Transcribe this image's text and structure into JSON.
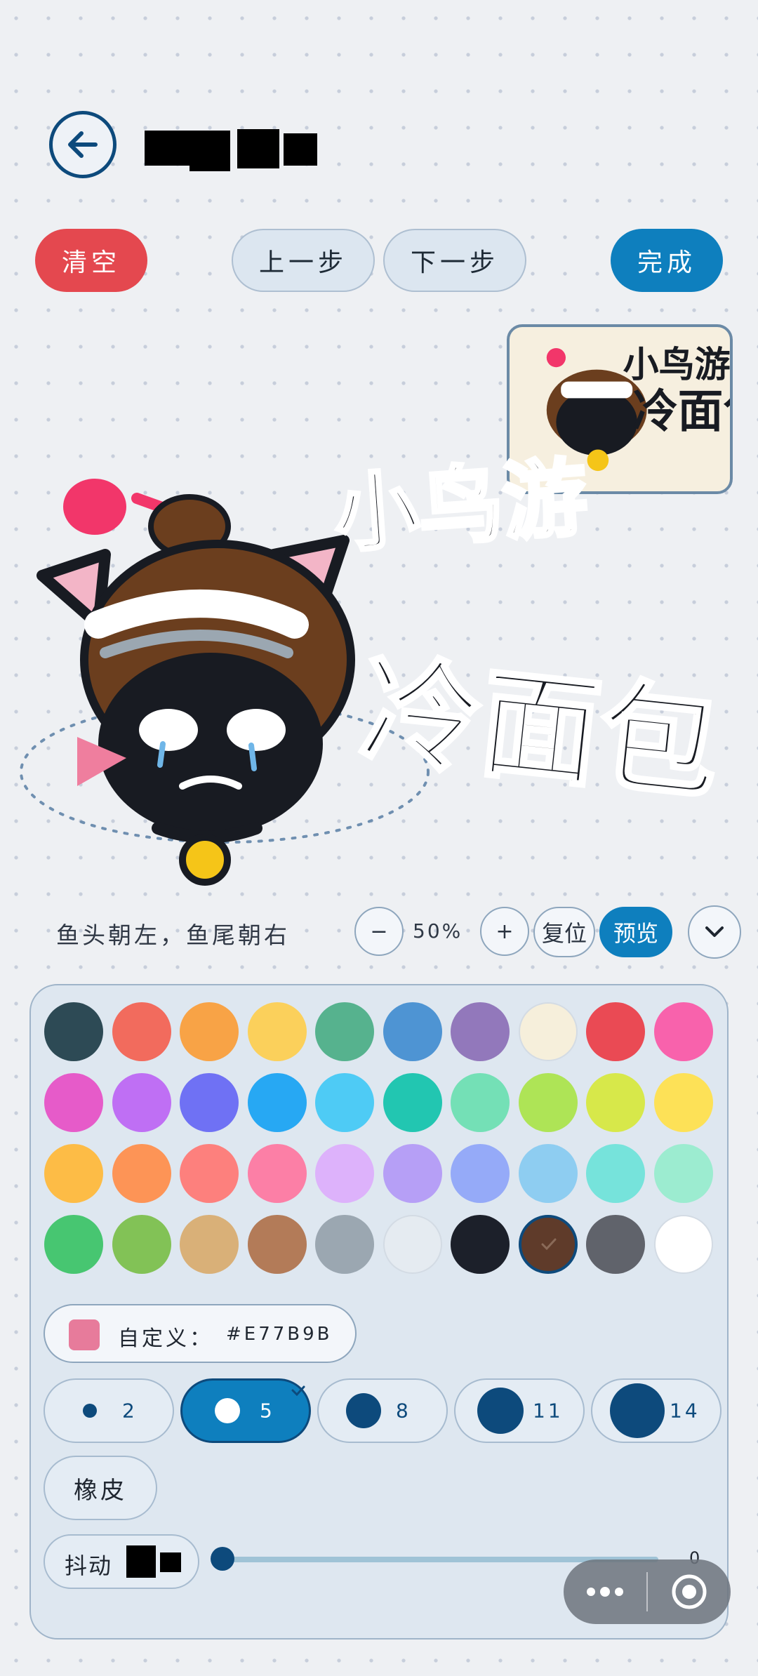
{
  "header": {
    "title": "████ █"
  },
  "toolbar": {
    "clear": "清空",
    "undo": "上一步",
    "redo": "下一步",
    "done": "完成"
  },
  "canvas": {
    "text_line1": "小鸟游",
    "text_line2": "冷面包"
  },
  "hint": "鱼头朝左，鱼尾朝右",
  "zoom": {
    "minus": "−",
    "value": "50%",
    "plus": "+",
    "reset": "复位",
    "preview": "预览"
  },
  "palette": {
    "colors": [
      "#2d4a55",
      "#f26b5d",
      "#f8a346",
      "#fbd05b",
      "#56b28e",
      "#4e94d3",
      "#9278bb",
      "#f6efdb",
      "#ea4a54",
      "#f862ac",
      "#e65bc9",
      "#bf6ff4",
      "#6f71f4",
      "#27a8f3",
      "#4ecbf5",
      "#22c6b1",
      "#74e0b6",
      "#aee456",
      "#d7e84a",
      "#fde157",
      "#fdbc46",
      "#fd9456",
      "#fd807d",
      "#fc7fa6",
      "#ddb2fb",
      "#b69ff6",
      "#95aaf8",
      "#8ecdf1",
      "#76e3db",
      "#9cecd0",
      "#47c671",
      "#82c256",
      "#d9b078",
      "#b37b58",
      "#9ba7b1",
      "#e5ebf1",
      "#1c202a",
      "#5f3b2a",
      "#60636b",
      "#ffffff"
    ],
    "selected_index": 37
  },
  "custom": {
    "label": "自定义：",
    "hex": "#E77B9B",
    "color": "#E77B9B"
  },
  "brushes": [
    {
      "label": "2",
      "size": 2
    },
    {
      "label": "5",
      "size": 5
    },
    {
      "label": "8",
      "size": 8
    },
    {
      "label": "11",
      "size": 11
    },
    {
      "label": "14",
      "size": 14
    }
  ],
  "brush_selected": 1,
  "eraser": "橡皮",
  "shake": {
    "label": "抖动",
    "value": "0",
    "level": 0
  },
  "capsule": {
    "more": "more-icon",
    "close": "target-icon"
  }
}
